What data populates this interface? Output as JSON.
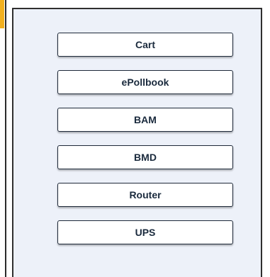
{
  "device_list": {
    "items": [
      {
        "id": "cart",
        "label": "Cart"
      },
      {
        "id": "epollbook",
        "label": "ePollbook"
      },
      {
        "id": "bam",
        "label": "BAM"
      },
      {
        "id": "bmd",
        "label": "BMD"
      },
      {
        "id": "router",
        "label": "Router"
      },
      {
        "id": "ups",
        "label": "UPS"
      }
    ]
  },
  "colors": {
    "accent": "#f2b01e",
    "panel_background": "#edf1f9",
    "button_background": "#ffffff",
    "button_text": "#1a2a3d",
    "border": "#2f2f2f"
  }
}
